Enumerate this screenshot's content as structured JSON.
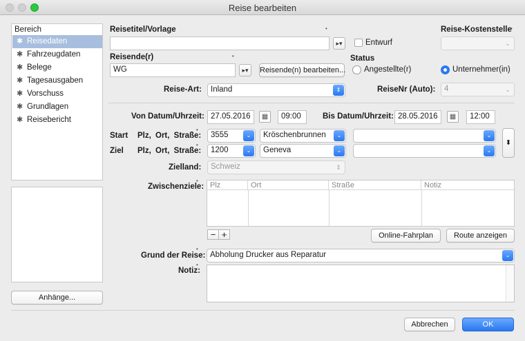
{
  "window": {
    "title": "Reise bearbeiten"
  },
  "sidebar": {
    "header": "Bereich",
    "items": [
      {
        "label": "Reisedaten",
        "icon": "gear-icon"
      },
      {
        "label": "Fahrzeugdaten",
        "icon": "gear-icon"
      },
      {
        "label": "Belege",
        "icon": "gear-icon"
      },
      {
        "label": "Tagesausgaben",
        "icon": "gear-icon"
      },
      {
        "label": "Vorschuss",
        "icon": "gear-icon"
      },
      {
        "label": "Grundlagen",
        "icon": "gear-icon"
      },
      {
        "label": "Reisebericht",
        "icon": "gear-icon"
      }
    ],
    "attachments_button": "Anhänge..."
  },
  "form": {
    "reisetitel_label": "Reisetitel/Vorlage",
    "reisetitel_value": "",
    "entwurf_label": "Entwurf",
    "kostenstelle_label": "Reise-Kostenstelle",
    "kostenstelle_value": "",
    "reisende_label": "Reisende(r)",
    "reisende_value": "WG",
    "reisende_edit_button": "Reisende(n) bearbeiten...",
    "status_label": "Status",
    "status_options": [
      "Angestellte(r)",
      "Unternehmer(in)"
    ],
    "status_selected": "Unternehmer(in)",
    "reiseart_label": "Reise-Art:",
    "reiseart_value": "Inland",
    "reisenr_label": "ReiseNr (Auto):",
    "reisenr_value": "4",
    "von_label": "Von Datum/Uhrzeit:",
    "von_date": "27.05.2016",
    "von_time": "09:00",
    "bis_label": "Bis Datum/Uhrzeit:",
    "bis_date": "28.05.2016",
    "bis_time": "12:00",
    "start_label": "Start",
    "ziel_label": "Ziel",
    "plz_ort_strasse_label": "Plz, Ort, Straße:",
    "start_plz": "3555",
    "start_ort": "Kröschenbrunnen",
    "start_strasse": "",
    "ziel_plz": "1200",
    "ziel_ort": "Geneva",
    "ziel_strasse": "",
    "zielland_label": "Zielland:",
    "zielland_value": "Schweiz",
    "zwischenziele_label": "Zwischenziele:",
    "zwischenziele_columns": [
      "Plz",
      "Ort",
      "Straße",
      "Notiz"
    ],
    "online_fahrplan_button": "Online-Fahrplan",
    "route_button": "Route anzeigen",
    "grund_label": "Grund der Reise:",
    "grund_value": "Abholung Drucker aus Reparatur",
    "notiz_label": "Notiz:",
    "notiz_value": ""
  },
  "footer": {
    "cancel": "Abbrechen",
    "ok": "OK"
  },
  "colors": {
    "accent": "#2a78f0",
    "selection": "#a7bede"
  }
}
